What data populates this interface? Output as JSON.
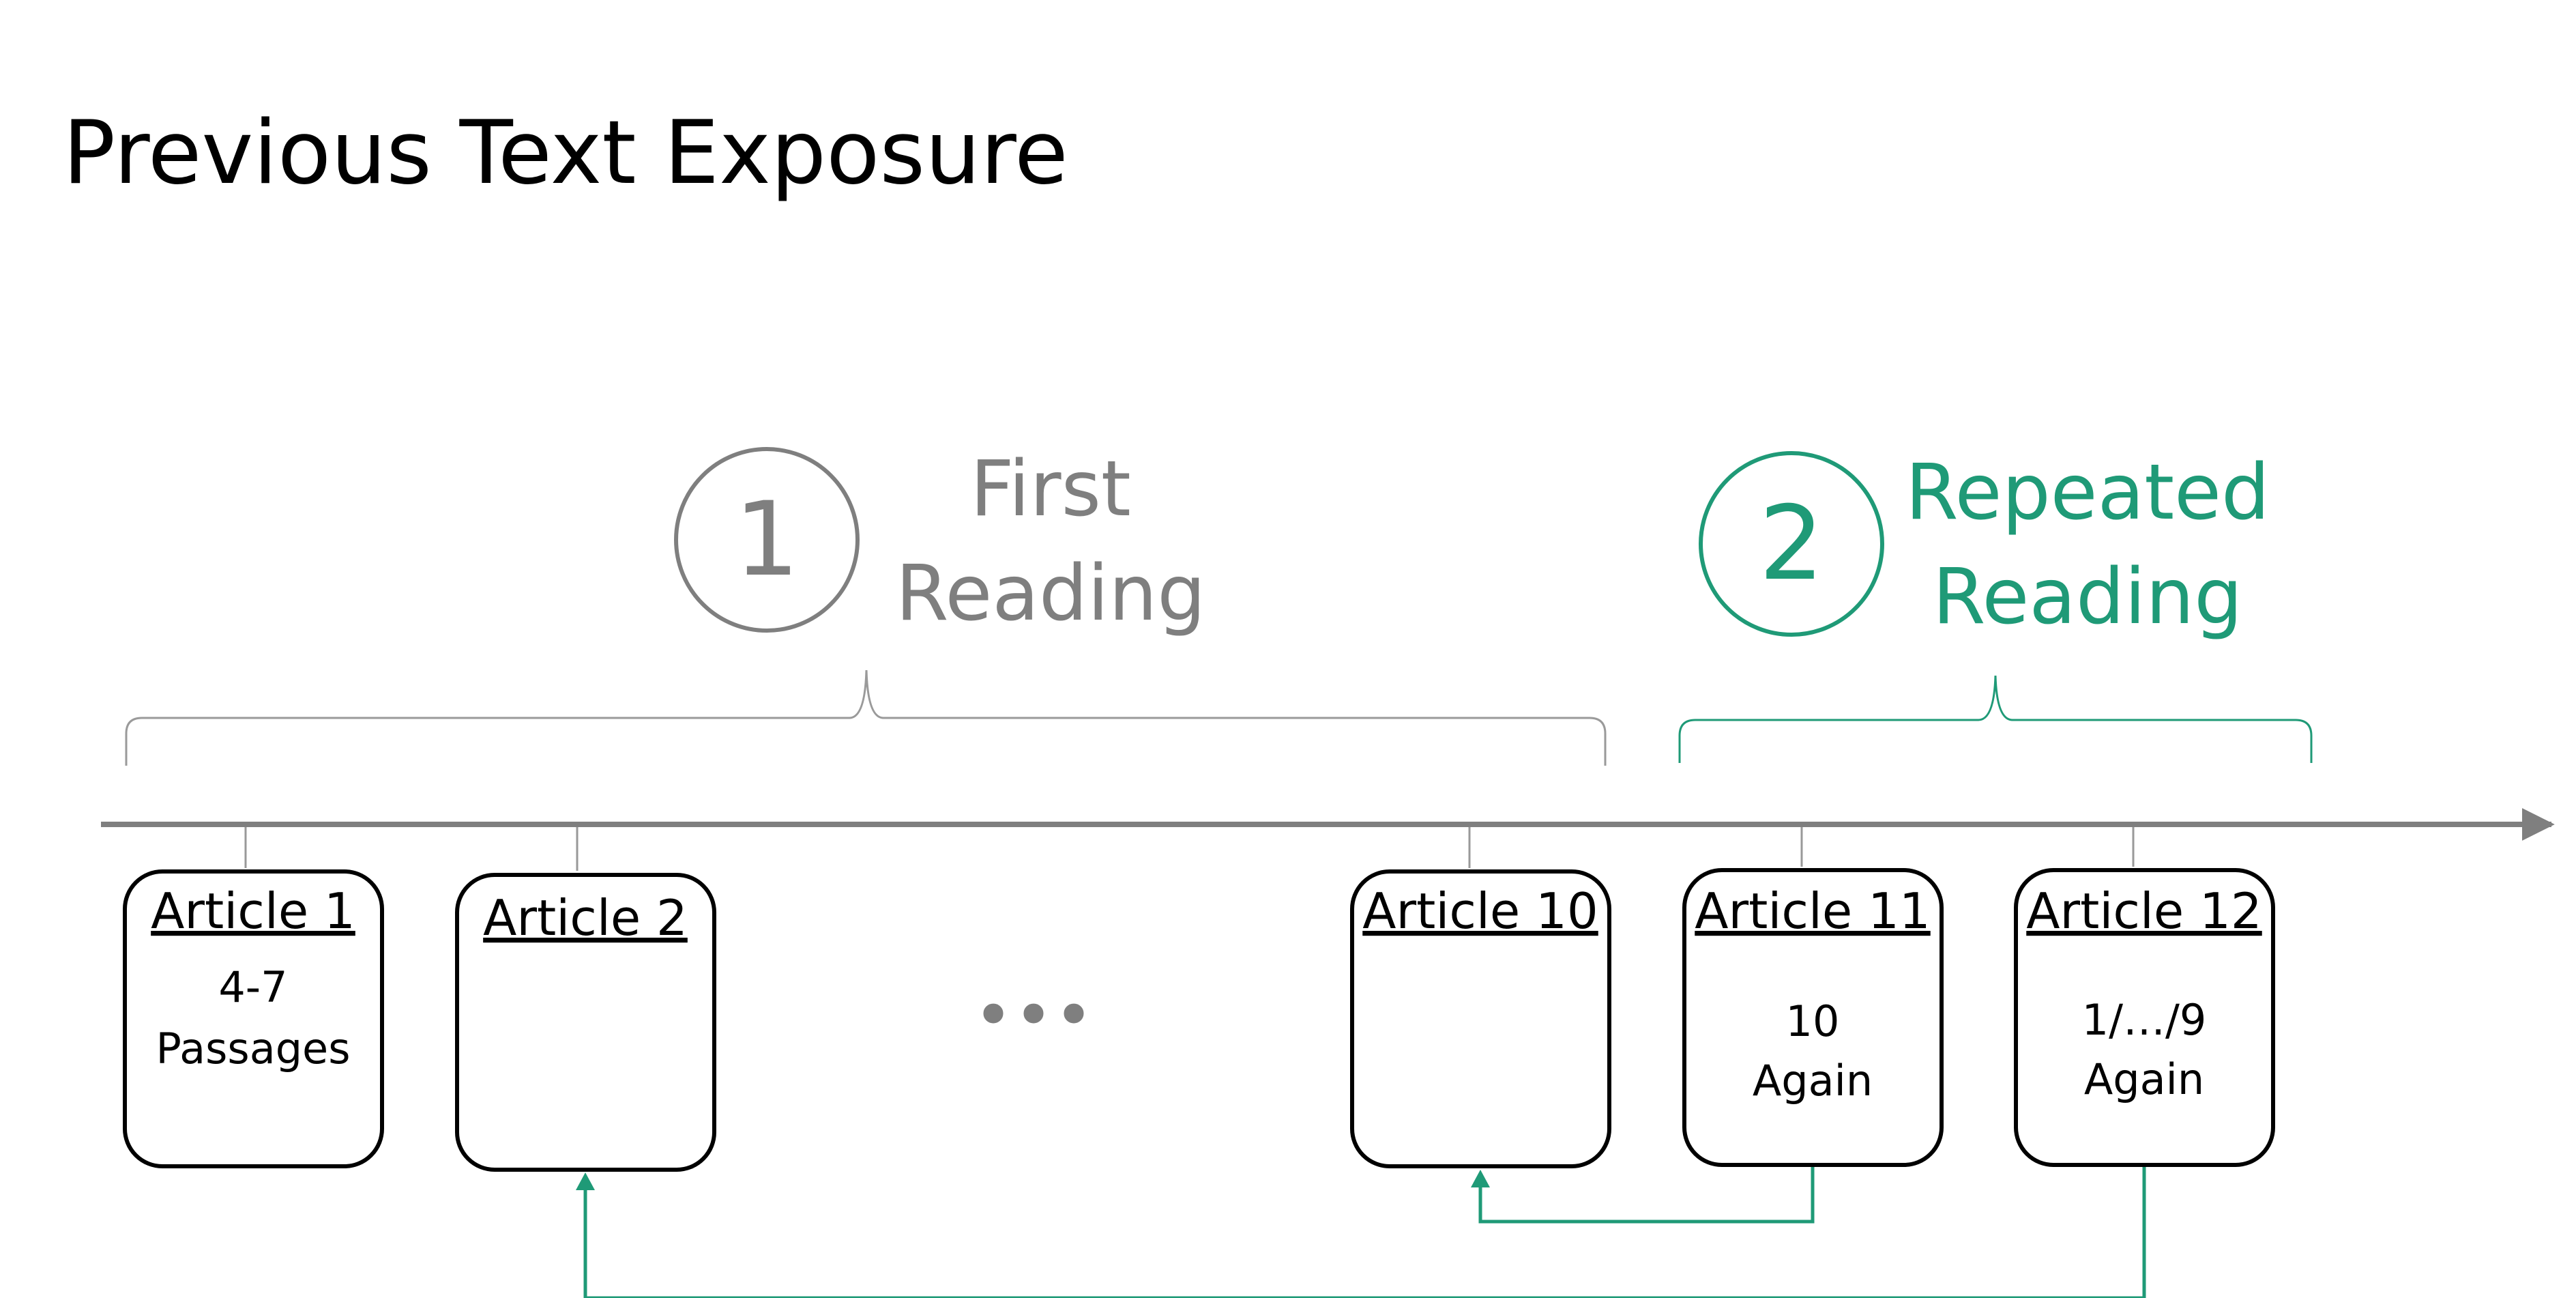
{
  "title": "Previous Text Exposure",
  "phases": [
    {
      "number": "1",
      "line1": "First",
      "line2": "Reading",
      "color": "#808080"
    },
    {
      "number": "2",
      "line1": "Repeated",
      "line2": "Reading",
      "color": "#1f9a77"
    }
  ],
  "ellipsis": "•••",
  "articles": [
    {
      "title": "Article 1",
      "line1": "4-7",
      "line2": "Passages"
    },
    {
      "title": "Article 2",
      "line1": "",
      "line2": ""
    },
    {
      "title": "Article 10",
      "line1": "",
      "line2": ""
    },
    {
      "title": "Article 11",
      "line1": "10",
      "line2": "Again"
    },
    {
      "title": "Article 12",
      "line1": "1/…/9",
      "line2": "Again"
    }
  ],
  "colors": {
    "timeline": "#7f7f7f",
    "box_border": "#000000",
    "accent": "#1f9a77",
    "muted": "#808080"
  }
}
